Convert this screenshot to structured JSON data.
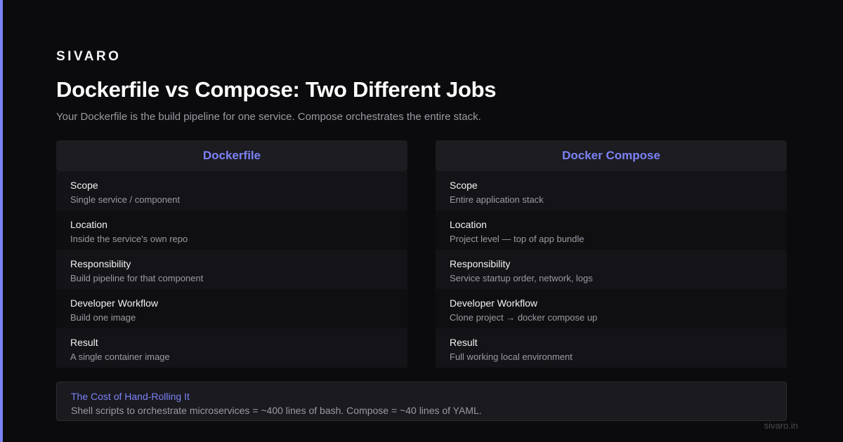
{
  "brand": "SIVARO",
  "title": "Dockerfile vs Compose: Two Different Jobs",
  "subtitle": "Your Dockerfile is the build pipeline for one service. Compose orchestrates the entire stack.",
  "colors": {
    "accent": "#7c83f7",
    "background": "#0b0b0d"
  },
  "dockerfile": {
    "heading": "Dockerfile",
    "rows": [
      {
        "label": "Scope",
        "value": "Single service / component"
      },
      {
        "label": "Location",
        "value": "Inside the service's own repo"
      },
      {
        "label": "Responsibility",
        "value": "Build pipeline for that component"
      },
      {
        "label": "Developer Workflow",
        "value": "Build one image"
      },
      {
        "label": "Result",
        "value": "A single container image"
      }
    ]
  },
  "compose": {
    "heading": "Docker Compose",
    "rows": [
      {
        "label": "Scope",
        "value": "Entire application stack"
      },
      {
        "label": "Location",
        "value": "Project level — top of app bundle"
      },
      {
        "label": "Responsibility",
        "value": "Service startup order, network, logs"
      },
      {
        "label": "Developer Workflow",
        "value": "Clone project → docker compose up"
      },
      {
        "label": "Result",
        "value": "Full working local environment"
      }
    ]
  },
  "callout": {
    "title": "The Cost of Hand-Rolling It",
    "text": "Shell scripts to orchestrate microservices = ~400 lines of bash. Compose = ~40 lines of YAML."
  },
  "footer": {
    "url": "sivaro.in"
  }
}
